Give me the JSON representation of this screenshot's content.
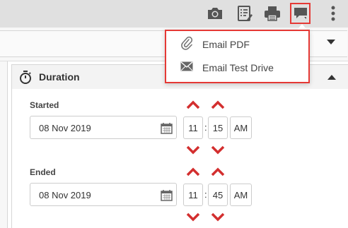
{
  "toolbar": {
    "icons": [
      "camera-icon",
      "checklist-icon",
      "printer-icon",
      "chat-icon",
      "more-vert-icon"
    ]
  },
  "menu": {
    "items": [
      {
        "label": "Email PDF",
        "icon": "paperclip-icon"
      },
      {
        "label": "Email Test Drive",
        "icon": "envelope-icon"
      }
    ]
  },
  "panel": {
    "title": "Duration"
  },
  "started": {
    "label": "Started",
    "date": "08 Nov 2019",
    "hour": "11",
    "minute": "15",
    "ampm": "AM"
  },
  "ended": {
    "label": "Ended",
    "date": "08 Nov 2019",
    "hour": "11",
    "minute": "45",
    "ampm": "AM"
  },
  "colors": {
    "accent_red": "#e53935",
    "toolbar_bg": "#e0e0e0",
    "icon_gray": "#555555",
    "chevron_red": "#d32f2f"
  }
}
